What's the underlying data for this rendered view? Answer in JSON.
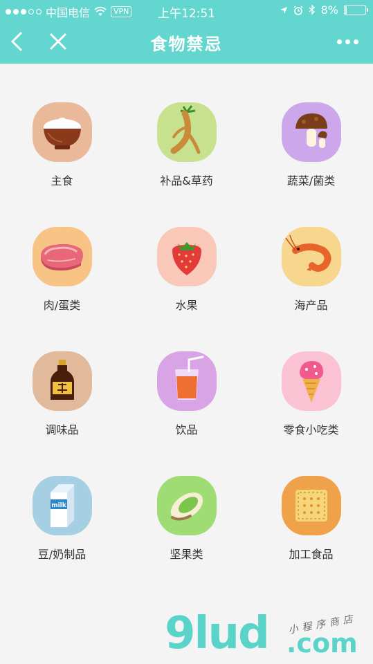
{
  "status_bar": {
    "carrier": "中国电信",
    "vpn": "VPN",
    "time": "上午12:51",
    "battery": "8%",
    "battery_level": 0.08
  },
  "navbar": {
    "title": "食物禁忌"
  },
  "categories": [
    {
      "label": "主食",
      "icon": "rice-bowl-icon",
      "bg": "#e9b999"
    },
    {
      "label": "补品&草药",
      "icon": "ginseng-icon",
      "bg": "#c8e18f"
    },
    {
      "label": "蔬菜/菌类",
      "icon": "mushroom-icon",
      "bg": "#cda7ec"
    },
    {
      "label": "肉/蛋类",
      "icon": "meat-icon",
      "bg": "#f7c486"
    },
    {
      "label": "水果",
      "icon": "strawberry-icon",
      "bg": "#f9c8b9"
    },
    {
      "label": "海产品",
      "icon": "shrimp-icon",
      "bg": "#f7d78d"
    },
    {
      "label": "调味品",
      "icon": "soy-sauce-icon",
      "bg": "#e1b99b"
    },
    {
      "label": "饮品",
      "icon": "juice-glass-icon",
      "bg": "#d9a4e5"
    },
    {
      "label": "零食小吃类",
      "icon": "ice-cream-icon",
      "bg": "#fac2d2"
    },
    {
      "label": "豆/奶制品",
      "icon": "milk-carton-icon",
      "bg": "#a7cfe4"
    },
    {
      "label": "坚果类",
      "icon": "pistachio-icon",
      "bg": "#9fdc73"
    },
    {
      "label": "加工食品",
      "icon": "biscuit-icon",
      "bg": "#f0a24a"
    }
  ],
  "watermark": {
    "main": "9lud",
    "com": ".com",
    "sub": "小程序商店"
  }
}
